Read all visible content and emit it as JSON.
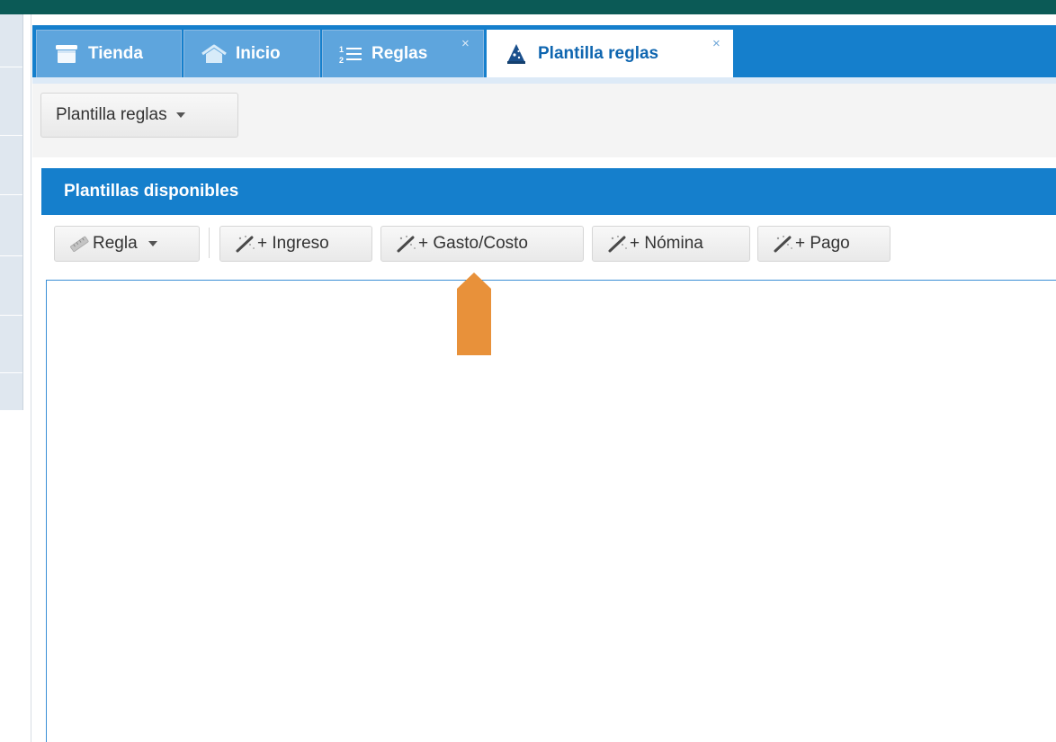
{
  "tabs": [
    {
      "label": "Tienda",
      "icon": "store-icon",
      "closable": false,
      "active": false
    },
    {
      "label": "Inicio",
      "icon": "home-icon",
      "closable": false,
      "active": false
    },
    {
      "label": "Reglas",
      "icon": "numbered-list-icon",
      "closable": true,
      "active": false
    },
    {
      "label": "Plantilla reglas",
      "icon": "wizard-hat-icon",
      "closable": true,
      "active": true
    }
  ],
  "tab_close_glyph": "×",
  "toolbar": {
    "template_menu_label": "Plantilla reglas"
  },
  "panel": {
    "title": "Plantillas disponibles",
    "buttons": {
      "regla": "Regla",
      "ingreso": "+ Ingreso",
      "gasto": "+ Gasto/Costo",
      "nomina": "+ Nómina",
      "pago": "+ Pago"
    }
  },
  "colors": {
    "accent": "#157fcc",
    "top_bar": "#0b5a56",
    "annotation_arrow": "#e8913a"
  }
}
